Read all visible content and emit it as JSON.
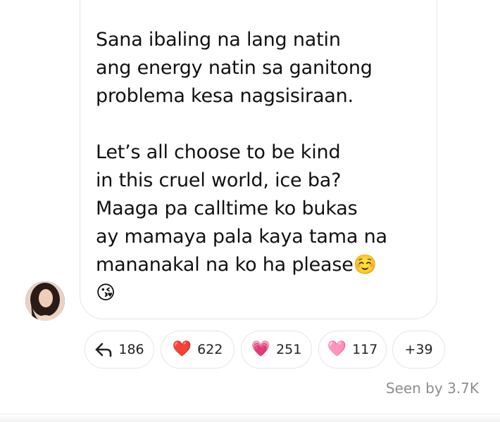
{
  "message": {
    "text": "Sana ibaling na lang natin\nang energy natin sa ganitong\nproblema kesa nagsisiraan.\n\nLet’s all choose to be kind\nin this cruel world, ice ba?\nMaaga pa calltime ko bukas\nay mamaya pala kaya tama na\nmananakal na ko ha please☺️\n😘"
  },
  "reactions": {
    "reply_icon": "reply-arrow-icon",
    "reply_count": "186",
    "items": [
      {
        "emoji": "❤️",
        "icon": "red-heart-icon",
        "count": "622"
      },
      {
        "emoji": "💗",
        "icon": "growing-heart-icon",
        "count": "251"
      },
      {
        "emoji": "🩷",
        "icon": "pink-heart-icon",
        "count": "117"
      }
    ],
    "more": "+39"
  },
  "seen": "Seen by 3.7K",
  "colors": {
    "bubble_border": "#e4e4e4",
    "seen_text": "#8e8e8e",
    "text": "#111111"
  }
}
